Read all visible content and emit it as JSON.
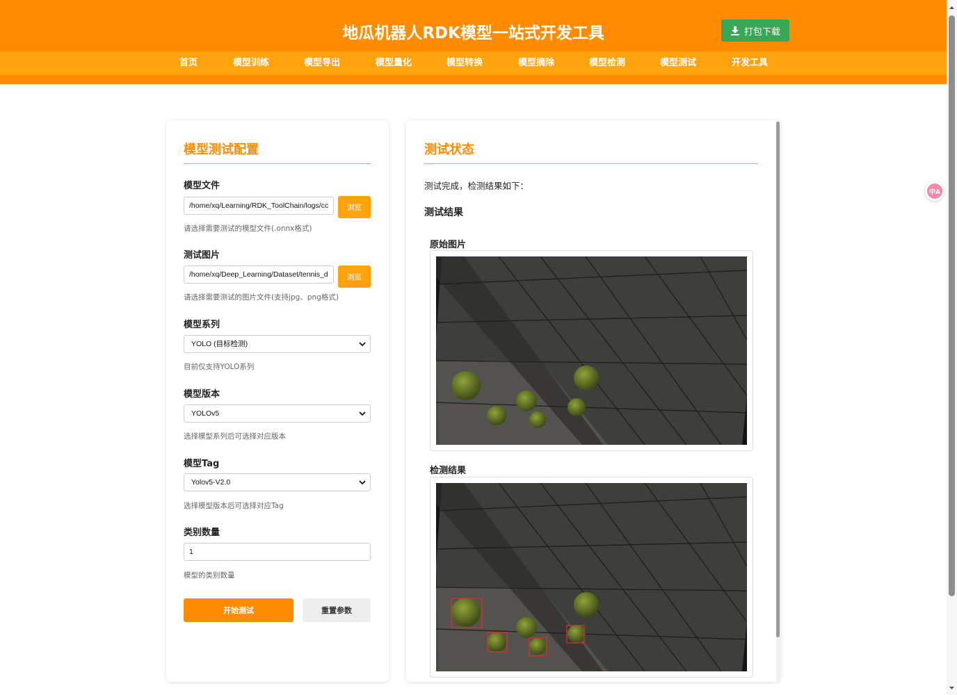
{
  "header": {
    "title": "地瓜机器人RDK模型一站式开发工具",
    "download_label": "打包下载",
    "download_icon": "download-icon",
    "brand_color": "#ff8c00",
    "nav_color": "#ffa20d",
    "download_color": "#3aa757"
  },
  "nav": {
    "items": [
      "首页",
      "模型训练",
      "模型导出",
      "模型量化",
      "模型转换",
      "模型摘除",
      "模型检测",
      "模型测试",
      "开发工具"
    ]
  },
  "config": {
    "title": "模型测试配置",
    "model_file": {
      "label": "模型文件",
      "value": "/home/xq/Learning/RDK_ToolChain/logs/cc",
      "browse": "浏览",
      "hint": "请选择需要测试的模型文件(.onnx格式)"
    },
    "test_image": {
      "label": "测试图片",
      "value": "/home/xq/Deep_Learning/Dataset/tennis_d",
      "browse": "浏览",
      "hint": "请选择需要测试的图片文件(支持jpg、png格式)"
    },
    "model_series": {
      "label": "模型系列",
      "selected": "YOLO (目标检测)",
      "hint": "目前仅支持YOLO系列"
    },
    "model_version": {
      "label": "模型版本",
      "selected": "YOLOv5",
      "hint": "选择模型系列后可选择对应版本"
    },
    "model_tag": {
      "label": "模型Tag",
      "selected": "Yolov5-V2.0",
      "hint": "选择模型版本后可选择对应Tag"
    },
    "class_count": {
      "label": "类别数量",
      "value": "1",
      "hint": "模型的类别数量"
    },
    "start_label": "开始测试",
    "reset_label": "重置参数"
  },
  "status": {
    "title": "测试状态",
    "message": "测试完成，检测结果如下：",
    "results_heading": "测试结果",
    "original_label": "原始图片",
    "detection_label": "检测结果"
  },
  "translate_fab": "中A"
}
